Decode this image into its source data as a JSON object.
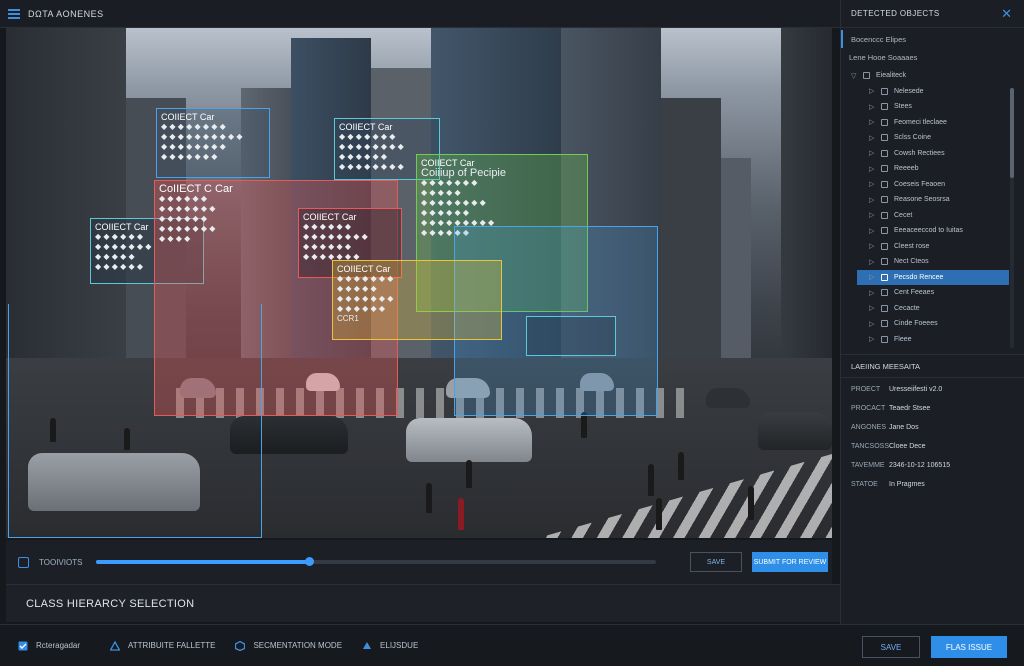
{
  "app": {
    "title": "DΩTA AONENES"
  },
  "bboxes": [
    {
      "title": "COIIECT Car",
      "lines": [
        "◆ ◆ ◆ ◆ ◆ ◆ ◆ ◆",
        "◆ ◆ ◆ ◆ ◆ ◆ ◆ ◆ ◆ ◆",
        "◆ ◆ ◆ ◆ ◆ ◆ ◆ ◆",
        "◆ ◆ ◆ ◆ ◆ ◆ ◆"
      ]
    },
    {
      "title": "COIIECT Car",
      "lines": [
        "◆ ◆ ◆ ◆ ◆ ◆ ◆",
        "◆ ◆ ◆ ◆ ◆ ◆ ◆ ◆",
        "◆ ◆ ◆ ◆ ◆ ◆",
        "◆ ◆ ◆ ◆ ◆ ◆ ◆ ◆"
      ]
    },
    {
      "title": "COIIECT Car",
      "lines": [
        "◆ ◆ ◆ ◆ ◆ ◆",
        "◆ ◆ ◆ ◆ ◆ ◆ ◆",
        "◆ ◆ ◆ ◆ ◆",
        "◆ ◆ ◆ ◆ ◆ ◆"
      ]
    },
    {
      "title": "COIIECT Car",
      "subtitle": "Coiiiup of Pecipie",
      "lines": [
        "◆ ◆ ◆ ◆ ◆ ◆ ◆",
        "◆ ◆ ◆ ◆ ◆",
        "◆ ◆ ◆ ◆ ◆ ◆ ◆ ◆",
        "◆ ◆ ◆ ◆ ◆ ◆",
        "◆ ◆ ◆ ◆ ◆ ◆ ◆ ◆ ◆",
        "◆ ◆ ◆ ◆ ◆ ◆"
      ]
    },
    {
      "title": "CoIIECT C Car",
      "lines": [
        "◆ ◆ ◆ ◆ ◆ ◆",
        "◆ ◆ ◆ ◆ ◆ ◆ ◆",
        "◆ ◆ ◆ ◆ ◆ ◆",
        "◆ ◆ ◆ ◆ ◆ ◆ ◆",
        "◆ ◆ ◆ ◆"
      ]
    },
    {
      "title": "COIIECT Car",
      "lines": [
        "◆ ◆ ◆ ◆ ◆ ◆",
        "◆ ◆ ◆ ◆ ◆ ◆ ◆ ◆",
        "◆ ◆ ◆ ◆ ◆ ◆",
        "◆ ◆ ◆ ◆ ◆ ◆ ◆"
      ]
    },
    {
      "title": "COIIECT Car",
      "lines": [
        "◆ ◆ ◆ ◆ ◆ ◆ ◆",
        "◆ ◆ ◆ ◆ ◆",
        "◆ ◆ ◆ ◆ ◆ ◆ ◆",
        "◆ ◆ ◆ ◆ ◆ ◆",
        "CCR1"
      ]
    }
  ],
  "progress": {
    "tools_label": "TOOIVIOTS",
    "value": 0.38,
    "save_label": "SAVE",
    "submit_label": "SUBMIT FOR REVIEW"
  },
  "class_bar": {
    "title": "CLASS HIERARCY SELECTION"
  },
  "bottom": {
    "items": [
      "Rcteragadar",
      "ATTRIBUITE FALLETTE",
      "SECMENTATION MODE",
      "ELIJSDUE"
    ],
    "save_label": "SAVE",
    "flag_label": "FLAS ISSUE"
  },
  "panel": {
    "title": "DETECTED OBJECTS",
    "section1": "Bocenccc Elipes",
    "section2": "Lene Hooe Soaaaes",
    "root": "Eiealiteck",
    "items": [
      "Nelesede",
      "Stees",
      "Feomeci tleclaee",
      "Sclss Coine",
      "Cowsh Rectiees",
      "Reeeeb",
      "Coeseis Feaoen",
      "Reasone Seosrsa",
      "Cecet",
      "Eeeaceeccod to Iuitas",
      "Cleest rose",
      "Nect Cteos",
      "Pecsdo Rencee",
      "Cent Feeaes",
      "Cecacte",
      "Cinde Foeees",
      "Fleee"
    ],
    "selected_index": 12,
    "meta_title": "LAEIING MEESAITA",
    "meta": [
      {
        "k": "PROECT",
        "v": "Uresseiifesti v2.0"
      },
      {
        "k": "PROCACT",
        "v": "Teaedr Stsee"
      },
      {
        "k": "ANGONES",
        "v": "Jane Dos"
      },
      {
        "k": "TANCSOSS",
        "v": "Cloee Dece"
      },
      {
        "k": "TAVEMME",
        "v": "2346-10-12 106515"
      },
      {
        "k": "STATOE",
        "v": "In Pragmes"
      }
    ]
  },
  "colors": {
    "accent": "#2f8fe8",
    "red_box": "#e85a5a",
    "green_box": "#6fcf4a",
    "yellow_box": "#e8c53a",
    "blue_box": "#4aa3e8",
    "cyan_box": "#5cc8d8"
  }
}
